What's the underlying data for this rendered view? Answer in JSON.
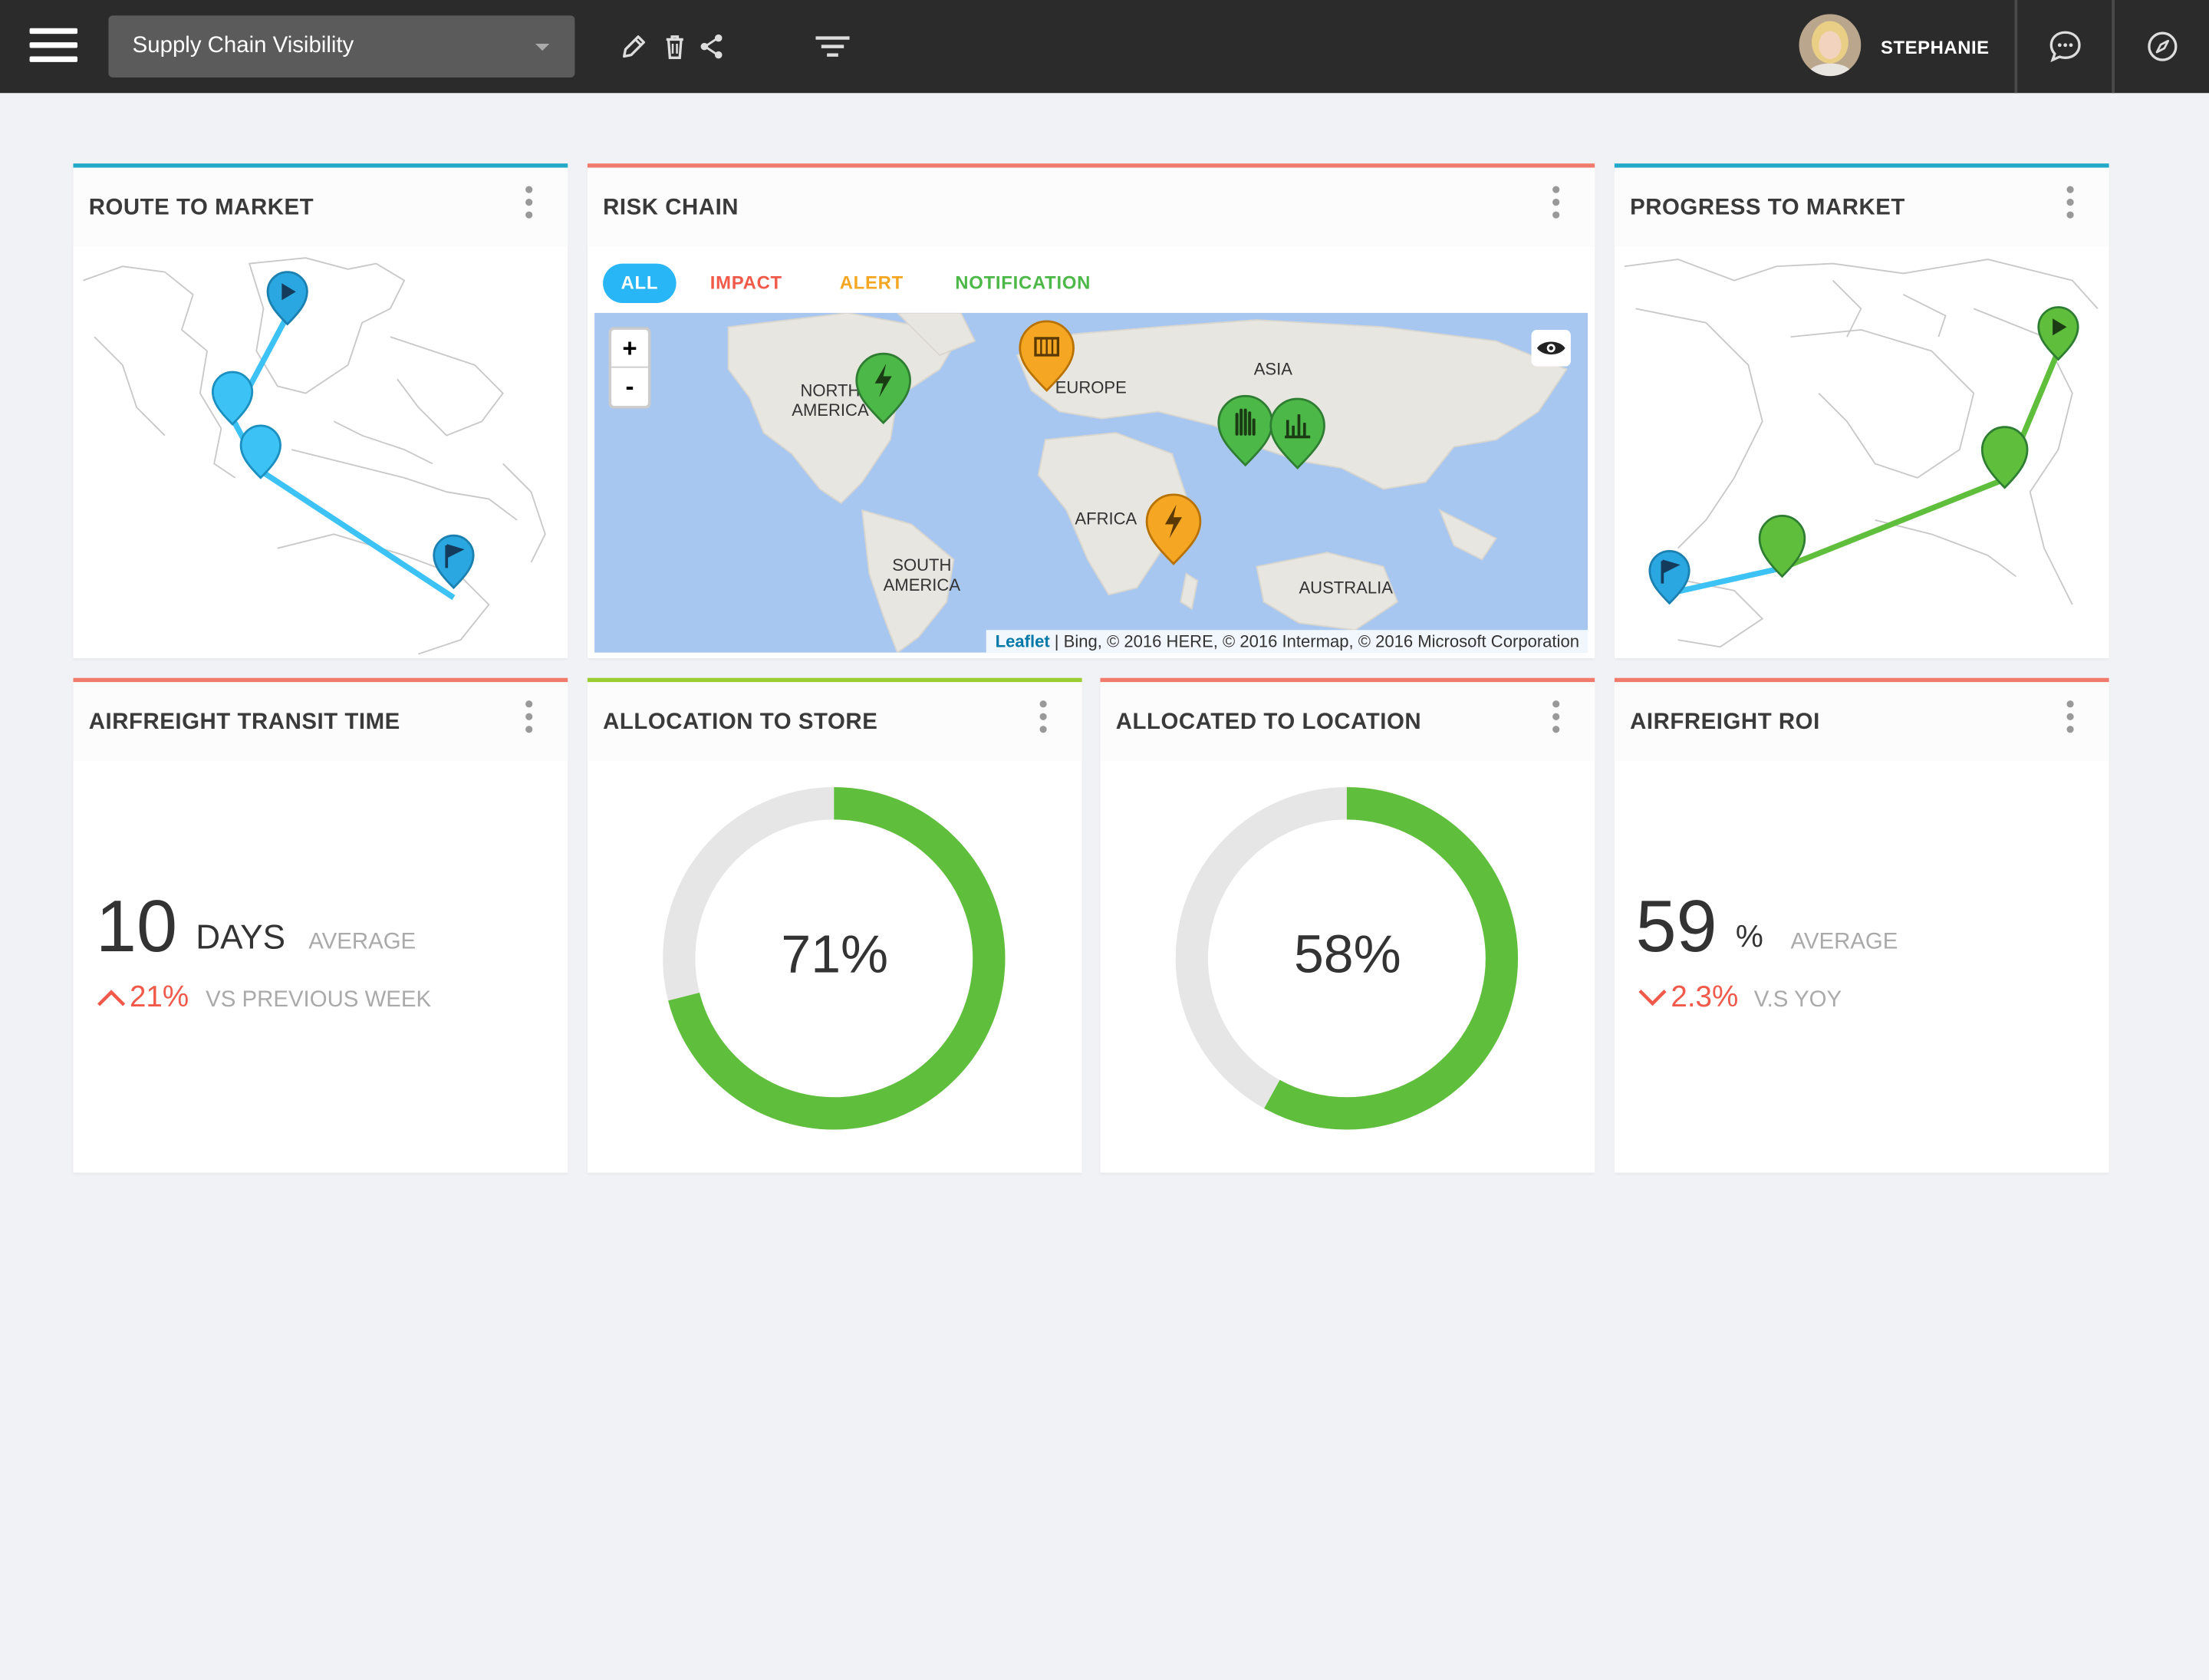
{
  "header": {
    "dashboard_select": "Supply Chain Visibility",
    "user_name": "STEPHANIE"
  },
  "colors": {
    "accent_blue": "#22a8c8",
    "accent_red": "#f07b6c",
    "accent_green": "#9acd32",
    "impact": "#f15a4a",
    "alert": "#f5a623",
    "notification": "#4cb848",
    "donut_fill": "#5fbf3c",
    "donut_track": "#e6e6e6"
  },
  "cards": {
    "route_to_market": {
      "title": "ROUTE TO MARKET"
    },
    "risk_chain": {
      "title": "RISK CHAIN",
      "filters": [
        "ALL",
        "IMPACT",
        "ALERT",
        "NOTIFICATION"
      ],
      "map_labels": {
        "north_america": "NORTH\nAMERICA",
        "europe": "EUROPE",
        "asia": "ASIA",
        "africa": "AFRICA",
        "south_america": "SOUTH\nAMERICA",
        "australia": "AUSTRALIA"
      },
      "zoom_in": "+",
      "zoom_out": "-",
      "attribution_link": "Leaflet",
      "attribution_text": " | Bing, © 2016 HERE, © 2016 Intermap, © 2016 Microsoft Corporation"
    },
    "progress_to_market": {
      "title": "PROGRESS TO MARKET"
    },
    "airfreight_transit_time": {
      "title": "AIRFREIGHT TRANSIT TIME",
      "value": "10",
      "unit": "DAYS",
      "qualifier": "AVERAGE",
      "delta": "21%",
      "comparison": "VS PREVIOUS WEEK"
    },
    "allocation_to_store": {
      "title": "ALLOCATION TO STORE",
      "percent": 71,
      "label": "71%"
    },
    "allocated_to_location": {
      "title": "ALLOCATED TO LOCATION",
      "percent": 58,
      "label": "58%"
    },
    "airfreight_roi": {
      "title": "AIRFREIGHT ROI",
      "value": "59",
      "unit": "%",
      "qualifier": "AVERAGE",
      "delta": "2.3%",
      "comparison": "V.S YOY"
    }
  }
}
